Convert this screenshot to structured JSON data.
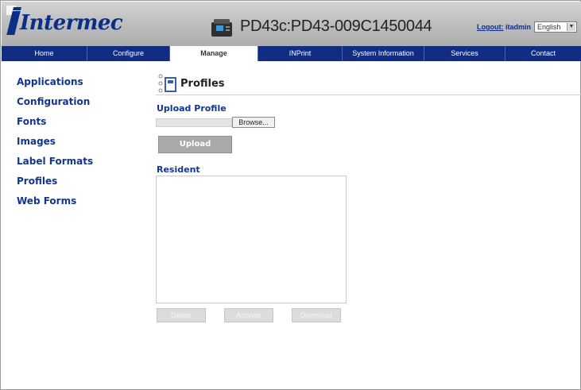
{
  "header": {
    "brand": "Intermec",
    "device_title": "PD43c:PD43-009C1450044",
    "logout_label": "Logout:",
    "user": "itadmin",
    "language": "English"
  },
  "nav": {
    "items": [
      {
        "label": "Home"
      },
      {
        "label": "Configure"
      },
      {
        "label": "Manage"
      },
      {
        "label": "INPrint"
      },
      {
        "label": "System Information"
      },
      {
        "label": "Services"
      },
      {
        "label": "Contact"
      }
    ],
    "active": "Manage"
  },
  "sidebar": {
    "items": [
      {
        "label": "Applications"
      },
      {
        "label": "Configuration"
      },
      {
        "label": "Fonts"
      },
      {
        "label": "Images"
      },
      {
        "label": "Label Formats"
      },
      {
        "label": "Profiles"
      },
      {
        "label": "Web Forms"
      }
    ],
    "active": "Profiles"
  },
  "main": {
    "title": "Profiles",
    "upload_section_label": "Upload Profile",
    "browse_label": "Browse...",
    "upload_label": "Upload",
    "resident_label": "Resident",
    "buttons": {
      "delete": "Delete",
      "activate": "Activate",
      "download": "Download"
    }
  },
  "colors": {
    "brand_blue": "#0c2f86",
    "nav_blue": "#122c82",
    "link_blue": "#13358f"
  }
}
